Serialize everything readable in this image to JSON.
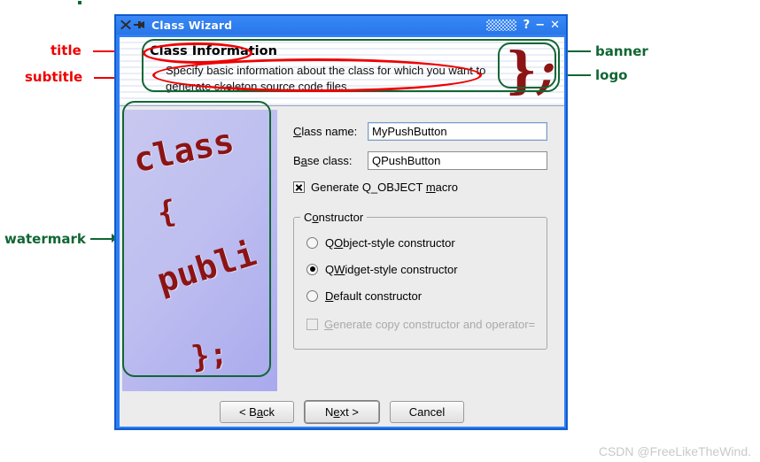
{
  "window": {
    "title": "Class Wizard",
    "icons": {
      "app": "x-icon",
      "pin": "pin-icon"
    },
    "controls": {
      "help": "?",
      "minimize": "−",
      "close": "✕"
    }
  },
  "banner": {
    "title": "Class Information",
    "subtitle": "Specify basic information about the class for which you want to generate skeleton source code files.",
    "logo_brace": "}",
    "logo_semicolon": ";"
  },
  "watermark": {
    "lines": [
      "class",
      "{",
      "publi",
      "};"
    ]
  },
  "form": {
    "class_name": {
      "label_pre": "",
      "label_mnemonic": "C",
      "label_post": "lass name:",
      "value": "MyPushButton"
    },
    "base_class": {
      "label_pre": "B",
      "label_mnemonic": "a",
      "label_post": "se class:",
      "value": "QPushButton"
    },
    "qobject_macro": {
      "pre": "Generate Q_OBJECT ",
      "mnemonic": "m",
      "post": "acro",
      "checked": true
    }
  },
  "constructor_group": {
    "legend_pre": "C",
    "legend_mnemonic": "o",
    "legend_post": "nstructor",
    "options": [
      {
        "pre": "Q",
        "mnemonic": "O",
        "post": "bject-style constructor",
        "selected": false
      },
      {
        "pre": "Q",
        "mnemonic": "W",
        "post": "idget-style constructor",
        "selected": true
      },
      {
        "pre": "",
        "mnemonic": "D",
        "post": "efault constructor",
        "selected": false
      }
    ],
    "copy_ctor": {
      "pre": "",
      "mnemonic": "G",
      "post": "enerate copy constructor and operator=",
      "checked": false,
      "disabled": true
    }
  },
  "buttons": [
    {
      "pre": "< B",
      "mnemonic": "a",
      "post": "ck",
      "default": false
    },
    {
      "pre": "N",
      "mnemonic": "e",
      "post": "xt >",
      "default": true
    },
    {
      "pre": "Cancel",
      "mnemonic": "",
      "post": "",
      "default": false
    }
  ],
  "annotations": {
    "title": "title",
    "subtitle": "subtitle",
    "banner": "banner",
    "logo": "logo",
    "watermark": "watermark",
    "colors": {
      "red": "#ee0000",
      "green": "#116633"
    }
  },
  "footer": {
    "credit": "CSDN @FreeLikeTheWind."
  }
}
